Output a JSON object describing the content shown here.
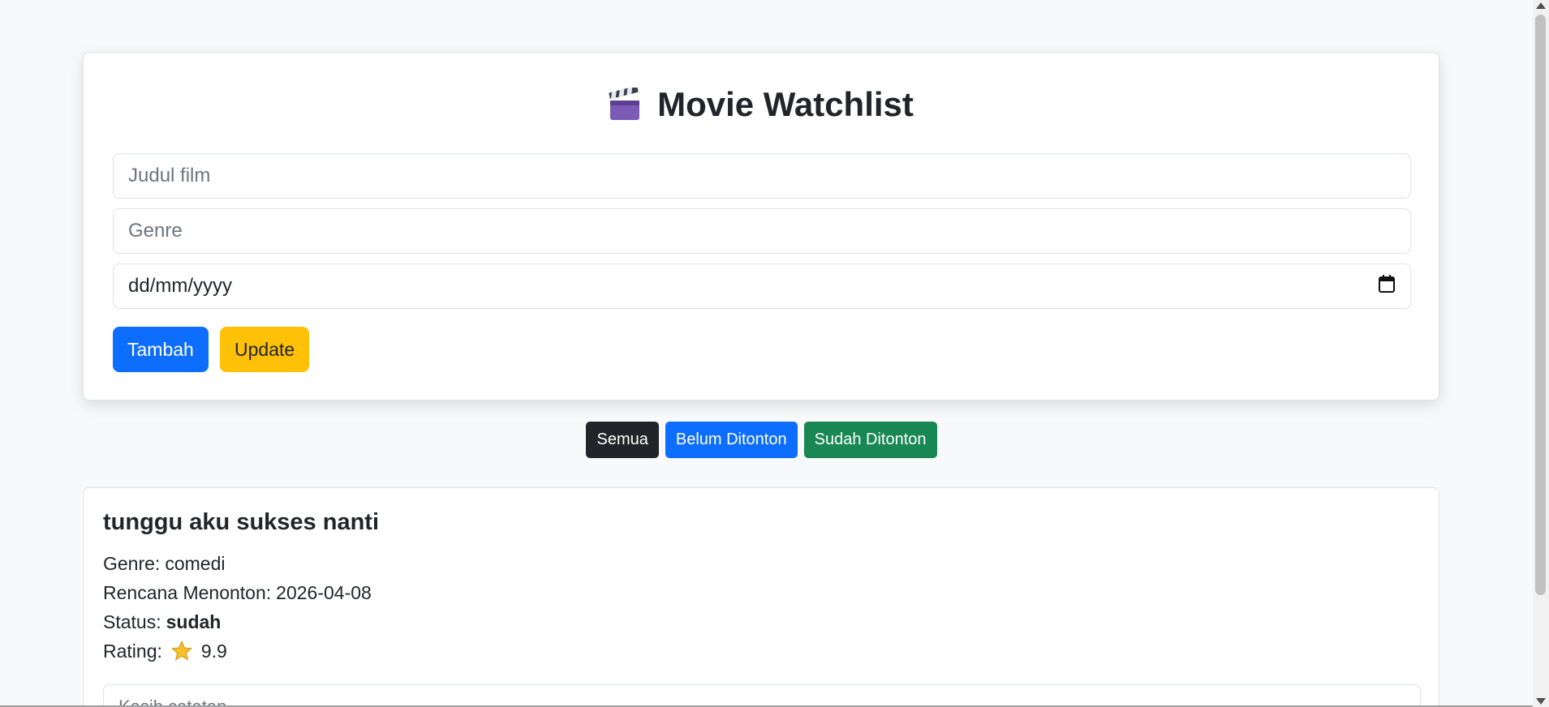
{
  "header": {
    "title": "Movie Watchlist",
    "icon": "clapperboard-icon"
  },
  "form": {
    "title_placeholder": "Judul film",
    "genre_placeholder": "Genre",
    "date_placeholder": "dd/mm/yyyy",
    "add_label": "Tambah",
    "update_label": "Update"
  },
  "filters": {
    "all_label": "Semua",
    "unwatched_label": "Belum Ditonton",
    "watched_label": "Sudah Ditonton"
  },
  "movies": [
    {
      "title": "tunggu aku sukses nanti",
      "genre_label": "Genre:",
      "genre": "comedi",
      "plan_label": "Rencana Menonton:",
      "plan_date": "2026-04-08",
      "status_label": "Status:",
      "status": "sudah",
      "rating_label": "Rating:",
      "rating": "9.9",
      "comment_placeholder": "Kasih catatan..."
    }
  ],
  "colors": {
    "primary": "#0d6efd",
    "warning": "#ffc107",
    "dark": "#212529",
    "success": "#198754",
    "background": "#f8f9fa"
  }
}
